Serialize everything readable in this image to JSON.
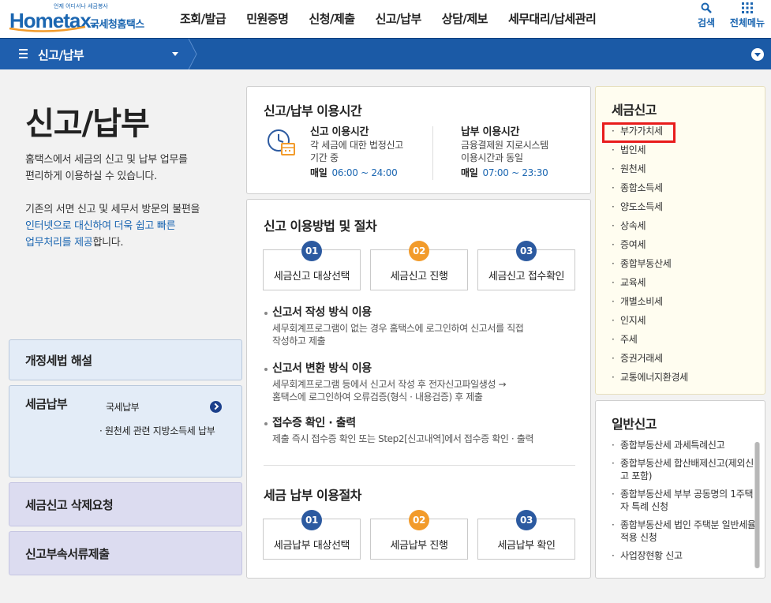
{
  "header": {
    "logo_tagline": "언제 어디서나 세금봉사",
    "logo_brand": "Hometax.",
    "logo_brand_ko": "국세청홈택스",
    "menu": [
      "조회/발급",
      "민원증명",
      "신청/제출",
      "신고/납부",
      "상담/제보",
      "세무대리/납세관리"
    ],
    "search_label": "검색",
    "all_menu_label": "전체메뉴"
  },
  "navbar": {
    "breadcrumb": "신고/납부"
  },
  "intro": {
    "title": "신고/납부",
    "desc1_line1": "홈택스에서 세금의 신고 및 납부 업무를",
    "desc1_line2": "편리하게 이용하실 수 있습니다.",
    "desc2_line1": "기존의 서면 신고 및 세무서 방문의 불편을",
    "desc2_line2": "인터넷으로 대신하여 더욱 쉽고 빠른",
    "desc2_line3a": "업무처리를 제공",
    "desc2_line3b": "합니다."
  },
  "sidebar": {
    "amend": "개정세법 해설",
    "pay_title": "세금납부",
    "pay_link1": "국세납부",
    "pay_link2": "· 원천세 관련 지방소득세 납부",
    "delete": "세금신고 삭제요청",
    "attach": "신고부속서류제출"
  },
  "hours": {
    "title": "신고/납부 이용시간",
    "report_head": "신고 이용시간",
    "report_desc1": "각 세금에 대한 법정신고",
    "report_desc2": "기간 중",
    "report_label": "매일",
    "report_time": "06:00 ~ 24:00",
    "pay_head": "납부 이용시간",
    "pay_desc1": "금융결제원 지로시스템",
    "pay_desc2": "이용시간과 동일",
    "pay_label": "매일",
    "pay_time": "07:00 ~ 23:30"
  },
  "procedure": {
    "title": "신고 이용방법 및 절차",
    "steps": [
      {
        "num": "01",
        "label": "세금신고 대상선택"
      },
      {
        "num": "02",
        "label": "세금신고 진행"
      },
      {
        "num": "03",
        "label": "세금신고 접수확인"
      }
    ],
    "methods": [
      {
        "head": "신고서 작성 방식 이용",
        "desc1": "세무회계프로그램이 없는 경우 홈택스에 로그인하여 신고서를 직접",
        "desc2": "작성하고 제출"
      },
      {
        "head": "신고서 변환 방식 이용",
        "desc1": "세무회계프로그램 등에서 신고서 작성 후 전자신고파일생성 →",
        "desc2": "홈택스에 로그인하여 오류검증(형식 · 내용검증) 후 제출"
      },
      {
        "head": "접수증 확인 · 출력",
        "desc1": "제출 즉시 접수증 확인 또는 Step2[신고내역]에서 접수증 확인 · 출력",
        "desc2": ""
      }
    ],
    "pay_title": "세금 납부 이용절차",
    "pay_steps": [
      {
        "num": "01",
        "label": "세금납부 대상선택"
      },
      {
        "num": "02",
        "label": "세금납부 진행"
      },
      {
        "num": "03",
        "label": "세금납부 확인"
      }
    ]
  },
  "tax_report": {
    "title": "세금신고",
    "items": [
      "부가가치세",
      "법인세",
      "원천세",
      "종합소득세",
      "양도소득세",
      "상속세",
      "증여세",
      "종합부동산세",
      "교육세",
      "개별소비세",
      "인지세",
      "주세",
      "증권거래세",
      "교통에너지환경세"
    ]
  },
  "general_report": {
    "title": "일반신고",
    "items": [
      "종합부동산세 과세특례신고",
      "종합부동산세 합산배제신고(제외신고 포함)",
      "종합부동산세 부부 공동명의 1주택자 특례 신청",
      "종합부동산세 법인 주택분 일반세율 적용 신청",
      "사업장현황 신고"
    ]
  },
  "colors": {
    "brand_blue": "#1b66b1",
    "nav_blue": "#1b5aa6",
    "step_blue": "#2c5aa0",
    "step_orange": "#f29b2b",
    "highlight_red": "#e81c1c"
  }
}
